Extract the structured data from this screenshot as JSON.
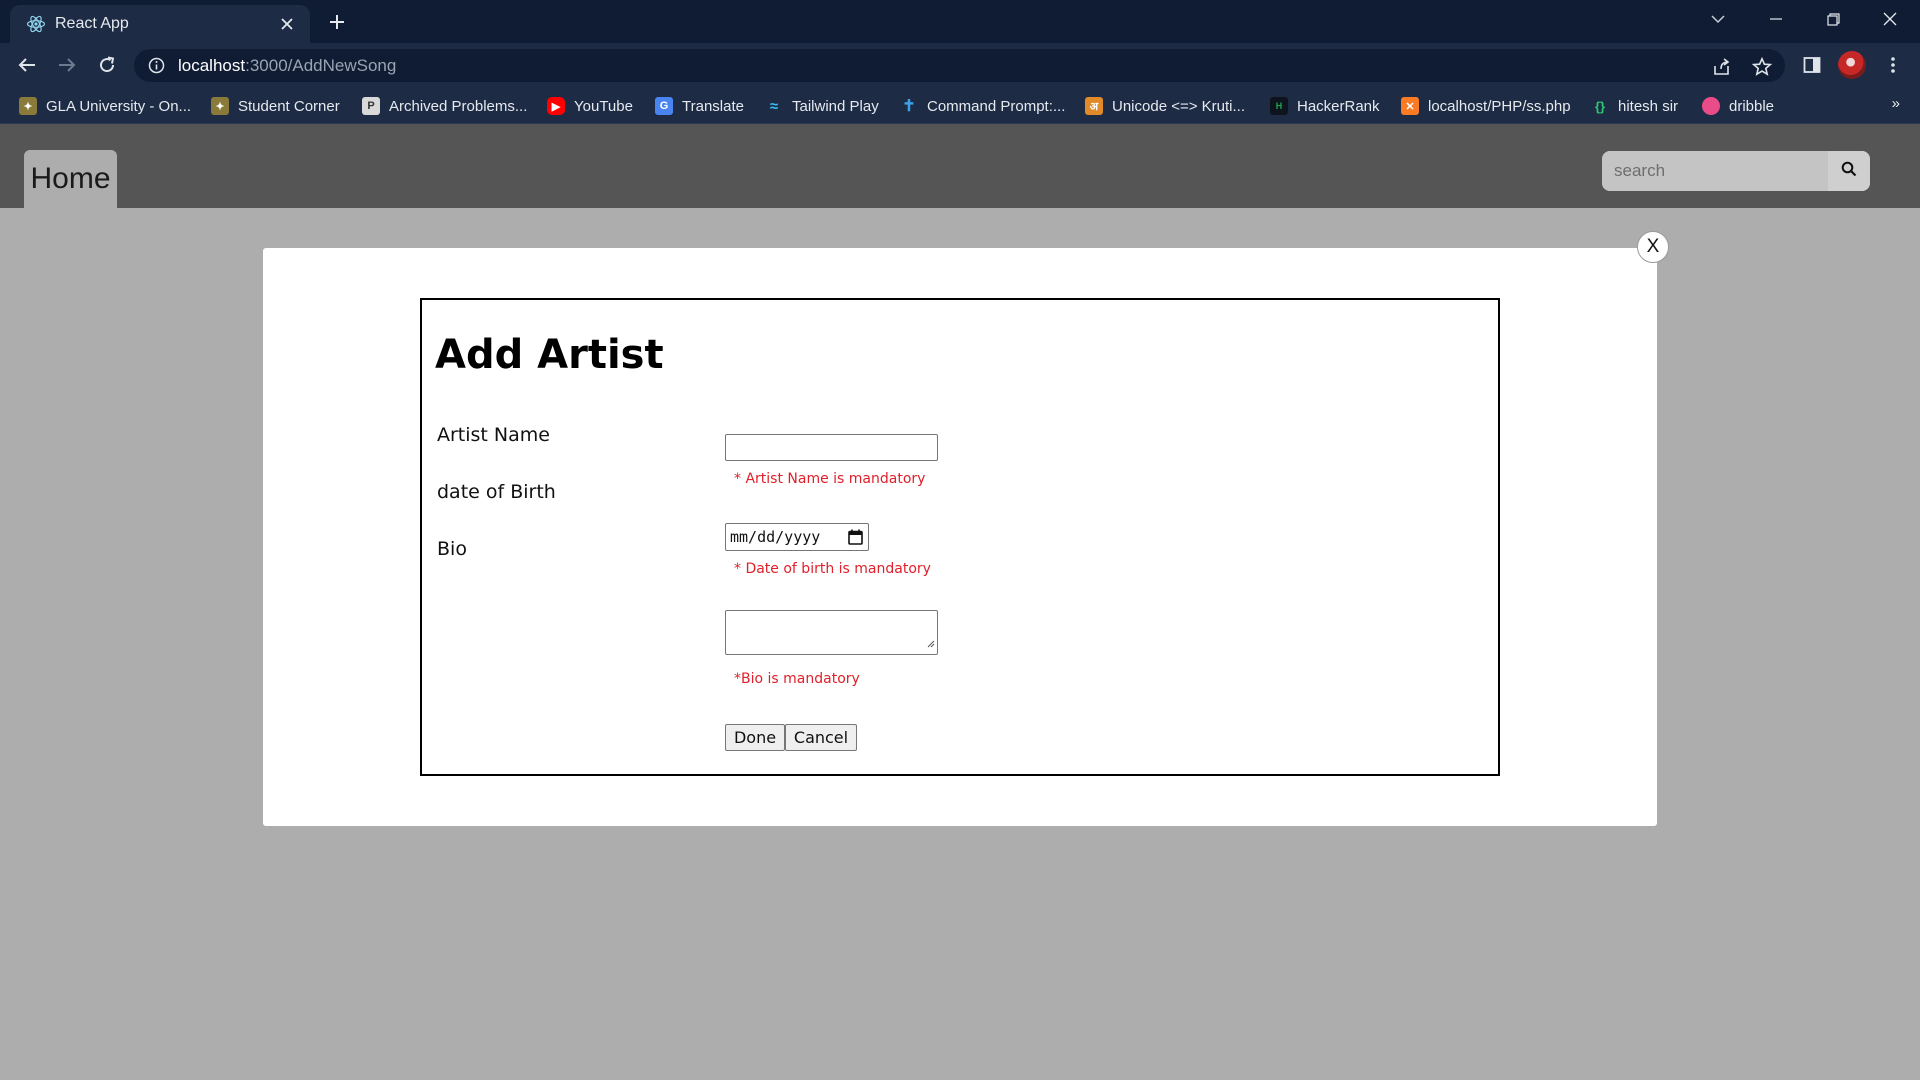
{
  "browser": {
    "tab_title": "React App",
    "url_host": "localhost",
    "url_rest": ":3000/AddNewSong",
    "bookmarks": [
      {
        "label": "GLA University - On...",
        "icon": "gla-icon",
        "color": "#8a7a3a"
      },
      {
        "label": "Student Corner",
        "icon": "gla-icon",
        "color": "#8a7a3a"
      },
      {
        "label": "Archived Problems...",
        "icon": "pe-icon",
        "color": "#d9d9d9"
      },
      {
        "label": "YouTube",
        "icon": "youtube-icon",
        "color": "#ff0000"
      },
      {
        "label": "Translate",
        "icon": "translate-icon",
        "color": "#4a84f0"
      },
      {
        "label": "Tailwind Play",
        "icon": "tailwind-icon",
        "color": "#38bdf8"
      },
      {
        "label": "Command Prompt:...",
        "icon": "cross-icon",
        "color": "#3aa0e8"
      },
      {
        "label": "Unicode <=> Kruti...",
        "icon": "unicode-icon",
        "color": "#e08a2a"
      },
      {
        "label": "HackerRank",
        "icon": "hackerrank-icon",
        "color": "#1ba94c"
      },
      {
        "label": "localhost/PHP/ss.php",
        "icon": "xampp-icon",
        "color": "#fb7a24"
      },
      {
        "label": "hitesh sir",
        "icon": "code-icon",
        "color": "#2ecc71"
      },
      {
        "label": "dribble",
        "icon": "dribbble-icon",
        "color": "#ea4c89"
      }
    ],
    "more_label": "»"
  },
  "navbar": {
    "home_label": "Home",
    "search_placeholder": "search"
  },
  "modal": {
    "close_label": "X",
    "title": "Add Artist",
    "labels": {
      "artist_name": "Artist Name",
      "dob": "date of Birth",
      "bio": "Bio"
    },
    "errors": {
      "artist_name": "* Artist Name is mandatory",
      "dob": "* Date of birth is mandatory",
      "bio": "*Bio is mandatory"
    },
    "date_placeholder": "mm/dd/yyyy",
    "buttons": {
      "done": "Done",
      "cancel": "Cancel"
    }
  },
  "colors": {
    "chrome_dark": "#0f1c33",
    "chrome_mid": "#1d2b45",
    "navbar": "#555555",
    "page_bg": "#adadad",
    "error": "#e0202a"
  }
}
